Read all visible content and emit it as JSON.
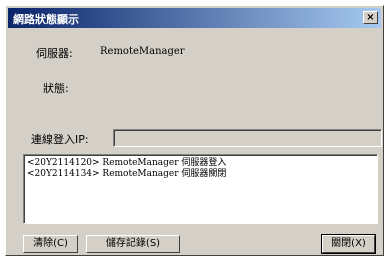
{
  "window": {
    "title": "網路狀態顯示",
    "close_glyph": "×"
  },
  "form": {
    "server_label": "伺服器:",
    "server_value": "RemoteManager",
    "status_label": "狀態:",
    "status_value": "",
    "ip_label": "連線登入IP:",
    "ip_value": ""
  },
  "log": {
    "lines": [
      "<20Y2114120> RemoteManager 伺服器登入",
      "<20Y2114134> RemoteManager 伺服器關閉"
    ]
  },
  "buttons": {
    "clear": "清除(C)",
    "save_log": "儲存記錄(S)",
    "close": "關閉(X)"
  }
}
